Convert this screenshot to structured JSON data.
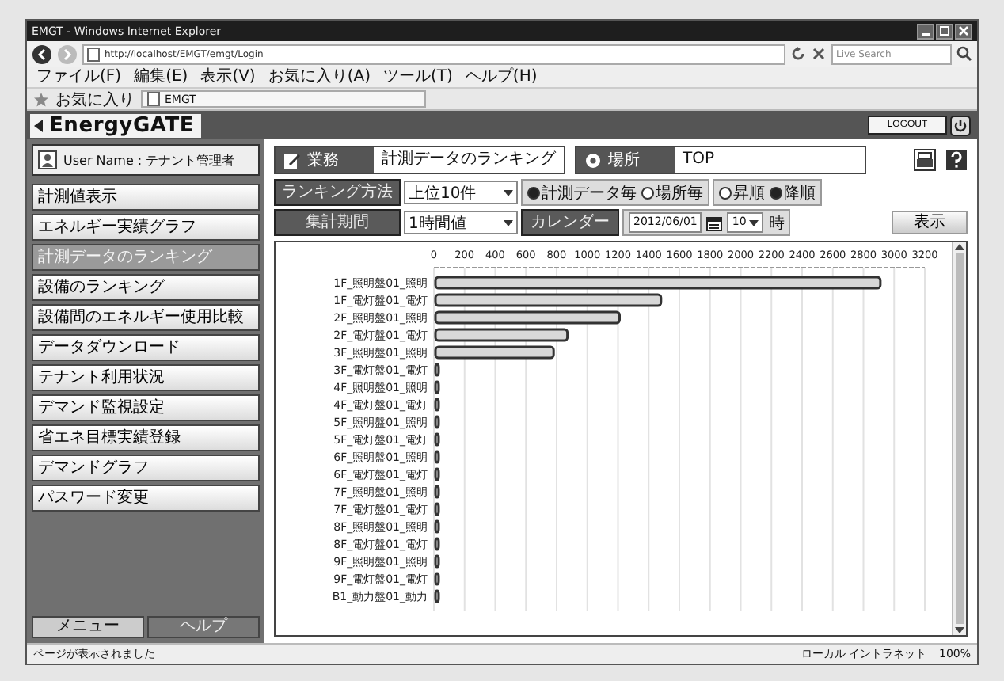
{
  "window": {
    "title": "EMGT - Windows Internet Explorer",
    "address": "http://localhost/EMGT/emgt/Login",
    "search_placeholder": "Live Search"
  },
  "menu": [
    "ファイル(F)",
    "編集(E)",
    "表示(V)",
    "お気に入り(A)",
    "ツール(T)",
    "ヘルプ(H)"
  ],
  "favorites": {
    "label": "お気に入り",
    "tab": "EMGT"
  },
  "app": {
    "logo": "EnergyGATE",
    "logout": "LOGOUT"
  },
  "sidebar": {
    "user": "User Name : テナント管理者",
    "items": [
      {
        "label": "計測値表示",
        "selected": false
      },
      {
        "label": "エネルギー実績グラフ",
        "selected": false
      },
      {
        "label": "計測データのランキング",
        "selected": true
      },
      {
        "label": "設備のランキング",
        "selected": false
      },
      {
        "label": "設備間のエネルギー使用比較",
        "selected": false
      },
      {
        "label": "データダウンロード",
        "selected": false
      },
      {
        "label": "テナント利用状況",
        "selected": false
      },
      {
        "label": "デマンド監視設定",
        "selected": false
      },
      {
        "label": "省エネ目標実績登録",
        "selected": false
      },
      {
        "label": "デマンドグラフ",
        "selected": false
      },
      {
        "label": "パスワード変更",
        "selected": false
      }
    ],
    "buttons": [
      {
        "label": "メニュー",
        "selected": true
      },
      {
        "label": "ヘルプ",
        "selected": false
      }
    ]
  },
  "header_fields": [
    {
      "label": "業務",
      "value": "計測データのランキング"
    },
    {
      "label": "場所",
      "value": "TOP"
    }
  ],
  "form": {
    "method_label": "ランキング方法",
    "method_value": "上位10件",
    "group_radios": [
      {
        "label": "計測データ毎",
        "selected": true
      },
      {
        "label": "場所毎",
        "selected": false
      }
    ],
    "order_radios": [
      {
        "label": "昇順",
        "selected": false
      },
      {
        "label": "降順",
        "selected": true
      }
    ],
    "period_label": "集計期間",
    "period_value": "1時間値",
    "calendar_label": "カレンダー",
    "date": "2012/06/01",
    "hour": "10",
    "hour_unit": "時",
    "show_button": "表示"
  },
  "chart": {
    "chart_data": {
      "type": "bar",
      "orientation": "horizontal",
      "categories": [
        "1F_照明盤01_照明",
        "1F_電灯盤01_電灯",
        "2F_照明盤01_照明",
        "2F_電灯盤01_電灯",
        "3F_照明盤01_照明",
        "3F_電灯盤01_電灯",
        "4F_照明盤01_照明",
        "4F_電灯盤01_電灯",
        "5F_照明盤01_照明",
        "5F_電灯盤01_電灯",
        "6F_照明盤01_照明",
        "6F_電灯盤01_電灯",
        "7F_照明盤01_照明",
        "7F_電灯盤01_電灯",
        "8F_照明盤01_照明",
        "8F_電灯盤01_電灯",
        "9F_照明盤01_照明",
        "9F_電灯盤01_電灯",
        "B1_動力盤01_動力"
      ],
      "values": [
        2900,
        1470,
        1200,
        860,
        770,
        20,
        20,
        20,
        20,
        20,
        20,
        20,
        20,
        20,
        20,
        20,
        20,
        20,
        20
      ],
      "grid": true,
      "xlim": [
        0,
        3200
      ],
      "xticks": [
        0,
        200,
        400,
        600,
        800,
        1000,
        1200,
        1400,
        1600,
        1800,
        2000,
        2200,
        2400,
        2600,
        2800,
        3000,
        3200
      ]
    }
  },
  "status_bar": {
    "text": "ページが表示されました",
    "zone": "ローカル イントラネット",
    "zoom": "100%"
  }
}
